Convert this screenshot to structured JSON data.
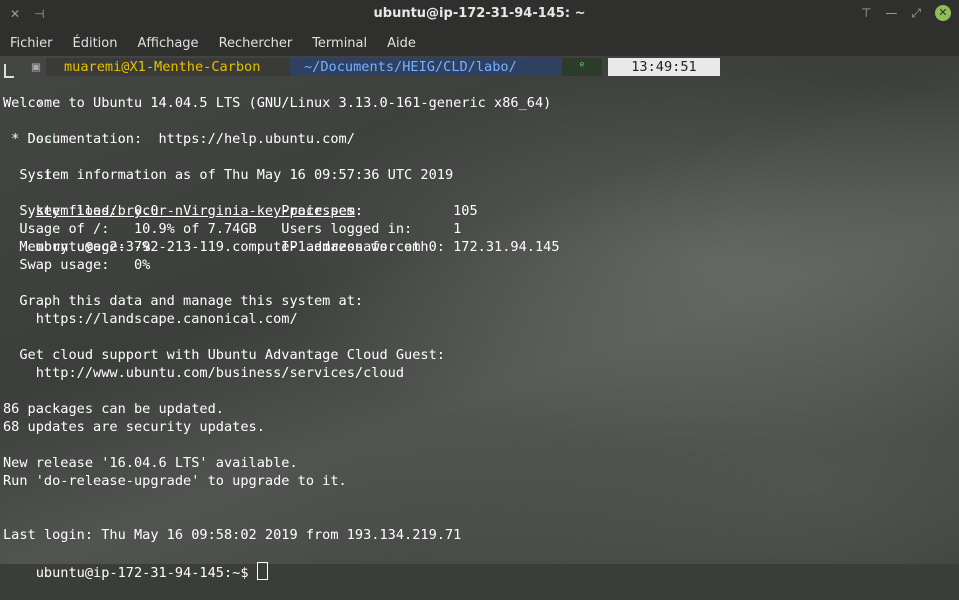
{
  "window": {
    "title": "ubuntu@ip-172-31-94-145: ~",
    "colors": {
      "accent_close": "#8fbf55",
      "titlebar_bg": "#2f302e"
    }
  },
  "menu": [
    "Fichier",
    "Édition",
    "Affichage",
    "Rechercher",
    "Terminal",
    "Aide"
  ],
  "prompt": {
    "user_host": "muaremi@X1-Menthe-Carbon",
    "path": "~/Documents/HEIG/CLD/labo/",
    "git_symbol": "ᵉ",
    "time": "13:49:51"
  },
  "command": {
    "arrow": "›",
    "program": "ssh",
    "flag": "-i",
    "key_file": "key files/brycur-nVirginia-key-pair.pem",
    "target": "ubuntu@ec2-3-92-213-119.compute-1.amazonaws.com"
  },
  "output_lines": [
    "Welcome to Ubuntu 14.04.5 LTS (GNU/Linux 3.13.0-161-generic x86_64)",
    "",
    " * Documentation:  https://help.ubuntu.com/",
    "",
    "  System information as of Thu May 16 09:57:36 UTC 2019",
    "",
    "  System load:  0.0               Processes:           105",
    "  Usage of /:   10.9% of 7.74GB   Users logged in:     1",
    "  Memory usage: 7%                IP address for eth0: 172.31.94.145",
    "  Swap usage:   0%",
    "",
    "  Graph this data and manage this system at:",
    "    https://landscape.canonical.com/",
    "",
    "  Get cloud support with Ubuntu Advantage Cloud Guest:",
    "    http://www.ubuntu.com/business/services/cloud",
    "",
    "86 packages can be updated.",
    "68 updates are security updates.",
    "",
    "New release '16.04.6 LTS' available.",
    "Run 'do-release-upgrade' to upgrade to it.",
    "",
    "",
    "Last login: Thu May 16 09:58:02 2019 from 193.134.219.71"
  ],
  "final_prompt": "ubuntu@ip-172-31-94-145:~$ "
}
